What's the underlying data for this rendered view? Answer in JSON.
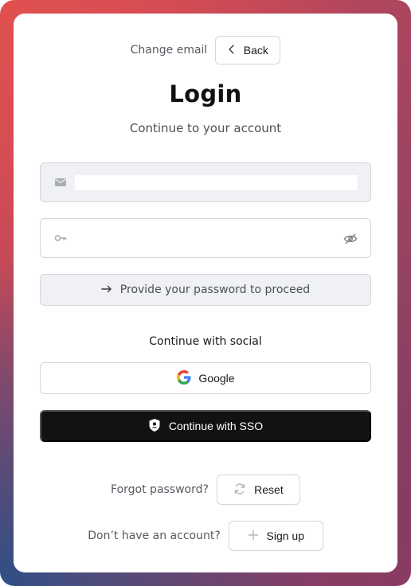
{
  "header": {
    "change_email_label": "Change email",
    "back_label": "Back"
  },
  "title": "Login",
  "subtitle": "Continue to your account",
  "email_field": {
    "value": "",
    "icon": "mail-icon"
  },
  "password_field": {
    "value": "",
    "icon": "key-icon",
    "toggle_icon": "eye-off-icon"
  },
  "proceed_button": {
    "label": "Provide your password to proceed",
    "icon": "arrow-right-icon"
  },
  "social": {
    "label": "Continue with social",
    "google_label": "Google",
    "sso_label": "Continue with SSO"
  },
  "footer": {
    "forgot_label": "Forgot password?",
    "reset_label": "Reset",
    "no_account_label": "Don’t have an account?",
    "signup_label": "Sign up"
  },
  "colors": {
    "primary_dark": "#121212",
    "muted_surface": "#f0f1f4",
    "border": "#d3d6db"
  }
}
